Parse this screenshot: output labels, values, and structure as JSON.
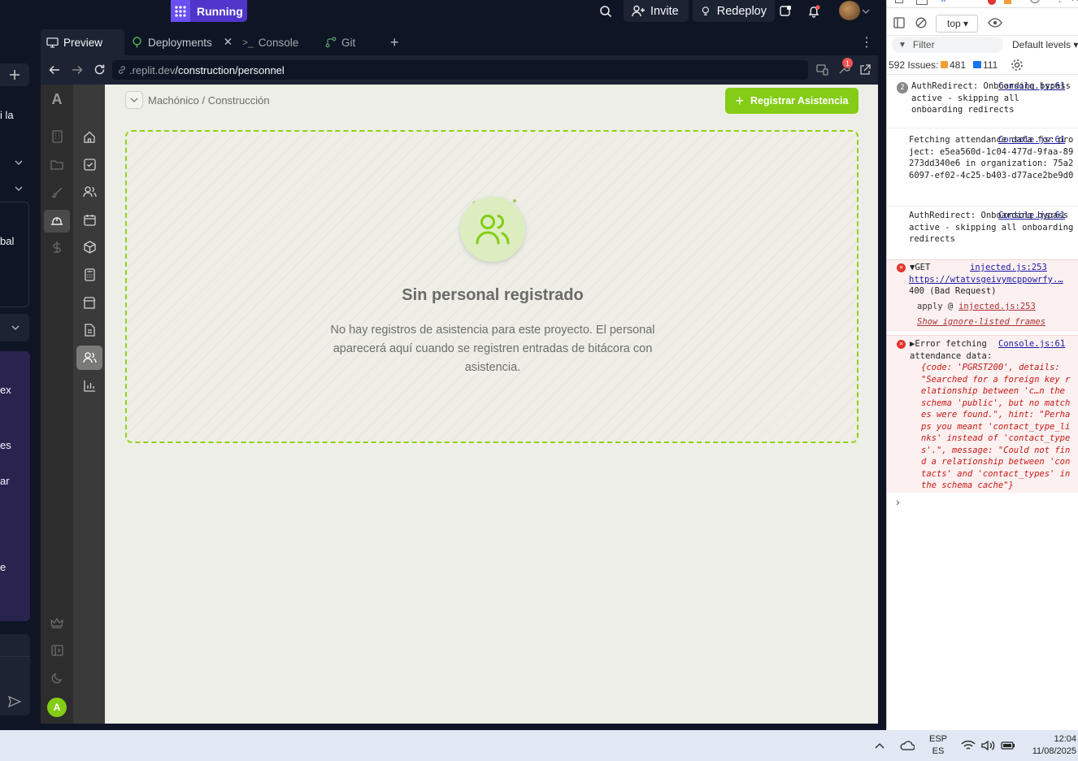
{
  "topbar": {
    "run_label": "Running",
    "invite_label": "Invite",
    "redeploy_label": "Redeploy"
  },
  "tabs": [
    {
      "label": "Preview"
    },
    {
      "label": "Deployments"
    },
    {
      "label": "Console"
    },
    {
      "label": "Git"
    }
  ],
  "url": {
    "prefix": ".replit.dev",
    "path": "/construction/personnel",
    "badge": "1"
  },
  "left_pane_fragments": [
    "i la",
    "bal",
    "ex",
    "es",
    "ar",
    "e"
  ],
  "app": {
    "logo": "A",
    "avatar": "A",
    "breadcrumb": "Machónico / Construcción",
    "register_button": "Registrar Asistencia",
    "empty_title": "Sin personal registrado",
    "empty_desc": "No hay registros de asistencia para este proyecto. El personal aparecerá aquí cuando se registren entradas de bitácora con asistencia."
  },
  "devtools": {
    "context": "top ▾",
    "filter_placeholder": "Filter",
    "levels": "Default levels ▾",
    "issues_label": "592 Issues:",
    "issues_warn": "481",
    "issues_info": "111",
    "logs": [
      {
        "count": "2",
        "text": "AuthRedirect: Onboarding bypass active - skipping all onboarding redirects",
        "src": "Console.js:61"
      },
      {
        "text": "Fetching attendance data for project: e5ea560d-1c04-477d-9faa-89273dd340e6 in organization: 75a26097-ef02-4c25-b403-d77ace2be9d0",
        "src": "Console.js:61"
      },
      {
        "text": "AuthRedirect: Onboarding bypass active - skipping all onboarding redirects",
        "src": "Console.js:61"
      }
    ],
    "get_error": {
      "method": "▼GET",
      "src": "injected.js:253",
      "url": "https://wtatvsgeivymcppowrfy.…",
      "status": "400 (Bad Request)",
      "apply": "apply @",
      "apply_src": "injected.js:253",
      "ignore": "Show ignore-listed frames"
    },
    "fetch_error": {
      "title": "▶Error fetching attendance data:",
      "src": "Console.js:61",
      "body": "{code: 'PGRST200', details: \"Searched for a foreign key relationship between 'c…n the schema 'public', but no matches were found.\", hint: \"Perhaps you meant 'contact_type_links' instead of 'contact_types'.\", message: \"Could not find a relationship between 'contacts' and 'contact_types' in the schema cache\"}"
    },
    "prompt": "›"
  },
  "taskbar": {
    "lang1": "ESP",
    "lang2": "ES",
    "time": "12:04",
    "date": "11/08/2025"
  }
}
